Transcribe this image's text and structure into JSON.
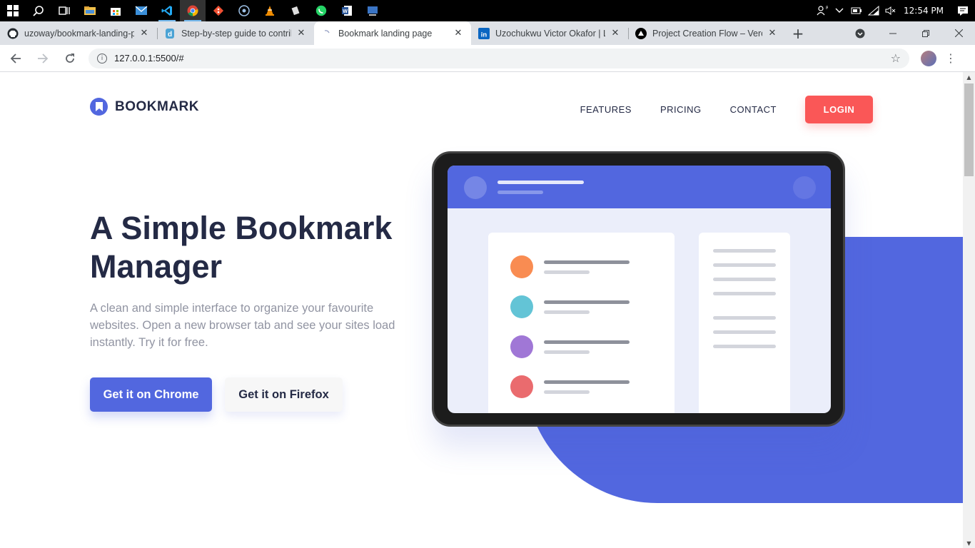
{
  "taskbar": {
    "icons": [
      "windows-start",
      "search",
      "task-view",
      "file-explorer",
      "store",
      "mail",
      "vscode",
      "chrome",
      "git",
      "app-circle",
      "vlc",
      "app-diamond",
      "whatsapp",
      "word",
      "app-screen"
    ],
    "clock": "12:54 PM"
  },
  "browser": {
    "tabs": [
      {
        "title": "uzoway/bookmark-landing-page",
        "favicon": "github-icon"
      },
      {
        "title": "Step-by-step guide to contributing",
        "favicon": "d-icon"
      },
      {
        "title": "Bookmark landing page",
        "favicon": "bookmark-favicon",
        "active": true
      },
      {
        "title": "Uzochukwu Victor Okafor | LinkedIn",
        "favicon": "linkedin-icon"
      },
      {
        "title": "Project Creation Flow – Vercel",
        "favicon": "vercel-icon"
      }
    ],
    "url": "127.0.0.1:5500/#"
  },
  "site": {
    "brand": "BOOKMARK",
    "nav": {
      "features": "FEATURES",
      "pricing": "PRICING",
      "contact": "CONTACT",
      "login": "LOGIN"
    },
    "hero": {
      "title": "A Simple Bookmark Manager",
      "subtitle": "A clean and simple interface to organize your favourite websites. Open a new browser tab and see your sites load instantly. Try it for free.",
      "cta_chrome": "Get it on Chrome",
      "cta_firefox": "Get it on Firefox"
    },
    "colors": {
      "primary": "#5267df",
      "accent_red": "#fa5757",
      "dark_text": "#242a45",
      "grey_text": "#9194a2",
      "row_dots": [
        "#f98c52",
        "#63c4d6",
        "#a077d6",
        "#ea6b6e"
      ]
    }
  }
}
